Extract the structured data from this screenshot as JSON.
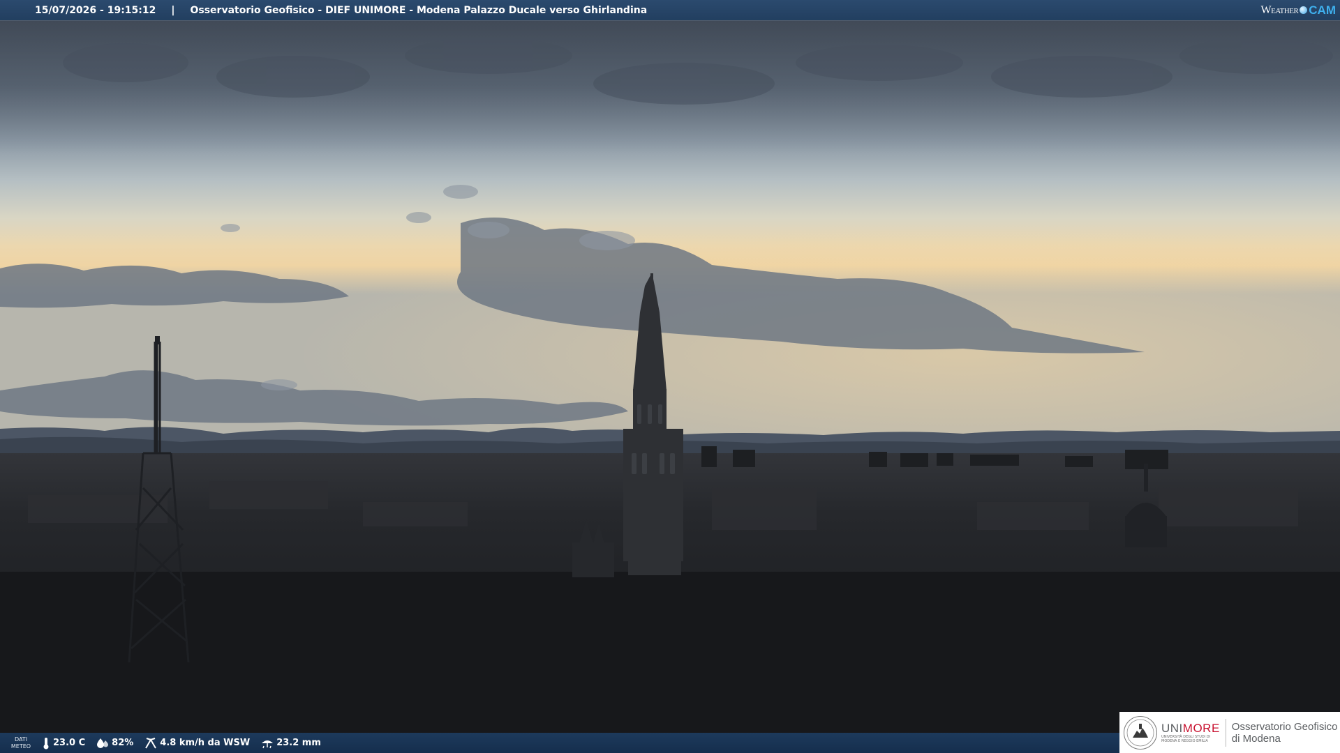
{
  "header": {
    "datetime": "15/07/2026 - 19:15:12",
    "separator": "|",
    "caption": "Osservatorio Geofisico - DIEF UNIMORE - Modena Palazzo Ducale verso Ghirlandina",
    "brand_weather": "Weather",
    "brand_cam": "CAM"
  },
  "weather": {
    "label_top": "DATI",
    "label_bottom": "METEO",
    "temperature": "23.0 C",
    "humidity": "82%",
    "wind": "4.8 km/h da WSW",
    "rain": "23.2 mm"
  },
  "logo": {
    "unimore_a": "UNI",
    "unimore_b": "MORE",
    "unimore_sub_1": "UNIVERSITÀ DEGLI STUDI DI",
    "unimore_sub_2": "MODENA E REGGIO EMILIA",
    "observatory_1": "Osservatorio Geofisico",
    "observatory_2": "di Modena"
  },
  "colors": {
    "sky_top": "#4f5b6a",
    "sky_horizon": "#e9d1a7",
    "city": "#1e2023",
    "header_bar": "#2b4a6e",
    "cam_accent": "#3fb1ef",
    "unimore_red": "#c8102e"
  },
  "icons": [
    "thermometer-icon",
    "humidity-icon",
    "wind-icon",
    "rain-icon",
    "weathercam-dot-icon",
    "unimore-seal-icon"
  ]
}
